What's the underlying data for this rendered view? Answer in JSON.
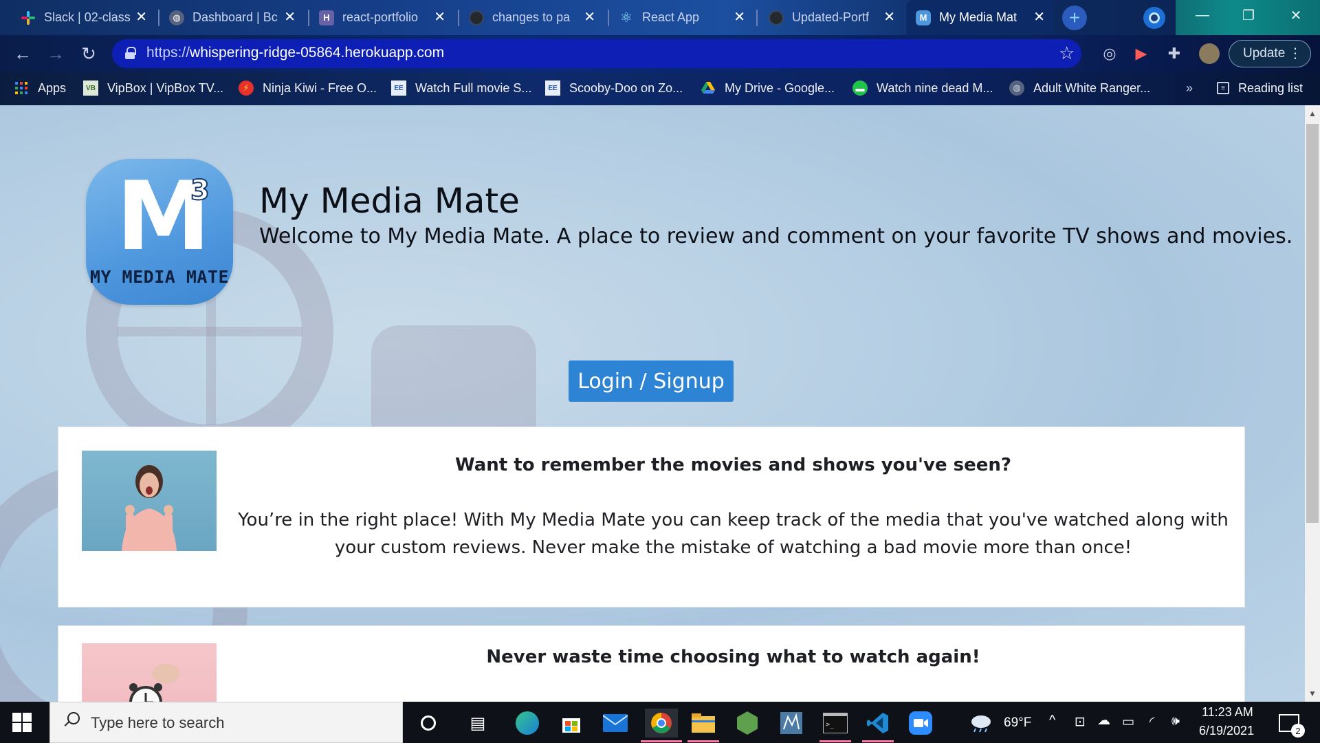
{
  "browser": {
    "tabs": [
      {
        "title": "Slack | 02-class",
        "favicon": "slack-icon",
        "color": "#e01e5a"
      },
      {
        "title": "Dashboard | Bc",
        "favicon": "globe-icon",
        "color": "#5f6b86"
      },
      {
        "title": "react-portfolio",
        "favicon": "heroku-icon",
        "glyph": "H",
        "color": "#6762a6"
      },
      {
        "title": "changes to pa",
        "favicon": "github-icon",
        "color": "#24292e"
      },
      {
        "title": "React App",
        "favicon": "react-icon",
        "glyph": "⚛",
        "color": "#1b2a44"
      },
      {
        "title": "Updated-Portf",
        "favicon": "github-icon",
        "color": "#24292e"
      },
      {
        "title": "My Media Mat",
        "favicon": "mymediamate-icon",
        "glyph": "M",
        "color": "#4e97de"
      }
    ],
    "url": {
      "scheme": "https://",
      "host": "whispering-ridge-05864.herokuapp.com"
    },
    "update_label": "Update",
    "bookmarks": [
      {
        "label": "Apps",
        "icon": "apps-grid-icon"
      },
      {
        "label": "VipBox | VipBox TV...",
        "icon": "vipbox-icon"
      },
      {
        "label": "Ninja Kiwi - Free O...",
        "icon": "ninja-kiwi-icon"
      },
      {
        "label": "Watch Full movie S...",
        "icon": "movie-site-icon"
      },
      {
        "label": "Scooby-Doo on Zo...",
        "icon": "movie-site-icon"
      },
      {
        "label": "My Drive - Google...",
        "icon": "google-drive-icon"
      },
      {
        "label": "Watch nine dead M...",
        "icon": "video-site-icon"
      },
      {
        "label": "Adult White Ranger...",
        "icon": "globe-icon"
      }
    ],
    "bookmarks_overflow": "»",
    "reading_list_label": "Reading list"
  },
  "page": {
    "logo": {
      "letter": "M",
      "superscript": "3",
      "caption": "MY MEDIA MATE"
    },
    "title": "My Media Mate",
    "tagline": "Welcome to My Media Mate. A place to review and comment on your favorite TV shows and movies.",
    "login_button": "Login / Signup",
    "cards": [
      {
        "title": "Want to remember the movies and shows you've seen?",
        "body": "You’re in the right place! With My Media Mate you can keep track of the media that you've watched along with your custom reviews. Never make the mistake of watching a bad movie more than once!",
        "image": "excited-woman-photo"
      },
      {
        "title": "Never waste time choosing what to watch again!",
        "body": "",
        "image": "alarm-clock-photo"
      }
    ]
  },
  "taskbar": {
    "search_placeholder": "Type here to search",
    "weather": "69°F",
    "time": "11:23 AM",
    "date": "6/19/2021",
    "notification_count": "2"
  }
}
